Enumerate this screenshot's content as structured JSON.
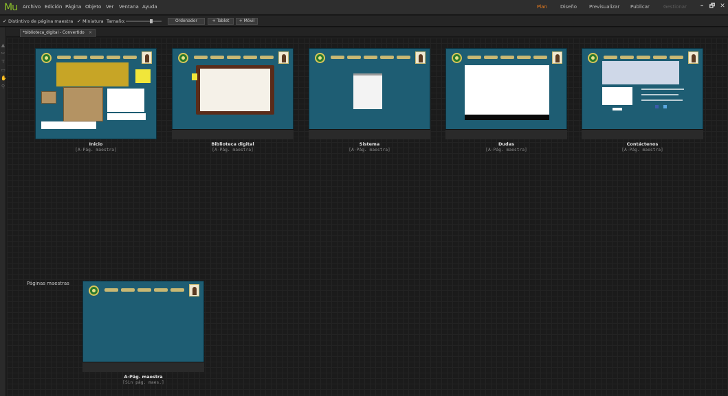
{
  "app": {
    "logo": "Mu"
  },
  "menu": [
    "Archivo",
    "Edición",
    "Página",
    "Objeto",
    "Ver",
    "Ventana",
    "Ayuda"
  ],
  "modes": [
    {
      "label": "Plan",
      "state": "active"
    },
    {
      "label": "Diseño",
      "state": "normal"
    },
    {
      "label": "Previsualizar",
      "state": "normal"
    },
    {
      "label": "Publicar",
      "state": "normal"
    },
    {
      "label": "Gestionar",
      "state": "disabled"
    }
  ],
  "window_controls": {
    "minimize": "–",
    "restore": "🗗",
    "close": "✕"
  },
  "options": {
    "master_badge": "Distintivo de página maestra",
    "thumbnail": "Miniatura",
    "size_label": "Tamaño:",
    "devices": [
      "Ordenador",
      "+ Tablet",
      "+ Móvil"
    ]
  },
  "document_tab": {
    "title": "*biblioteca_digital - Convertido",
    "close": "×"
  },
  "pages": [
    {
      "name": "Inicio",
      "master": "[A-Pág. maestra]"
    },
    {
      "name": "Biblioteca digital",
      "master": "[A-Pág. maestra]"
    },
    {
      "name": "Sistema",
      "master": "[A-Pág. maestra]"
    },
    {
      "name": "Dudas",
      "master": "[A-Pág. maestra]"
    },
    {
      "name": "Contáctenos",
      "master": "[A-Pág. maestra]"
    }
  ],
  "masters_section": {
    "label": "Páginas maestras",
    "items": [
      {
        "name": "A-Pág. maestra",
        "master": "[Sin pág. maes.]"
      }
    ]
  },
  "colors": {
    "accent": "#e87b1e",
    "page_bg": "#1e5d73",
    "canvas": "#1b1b1b"
  }
}
